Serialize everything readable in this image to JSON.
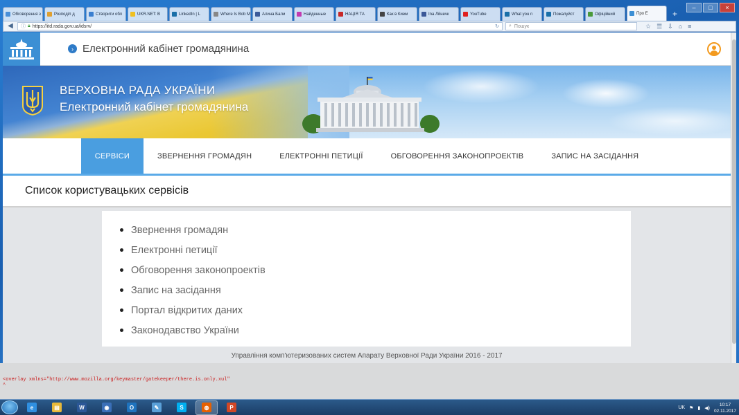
{
  "browser": {
    "tabs": [
      {
        "label": "Обговорення з",
        "color": "#4a8fd8"
      },
      {
        "label": "Розподіл д",
        "color": "#e0a030"
      },
      {
        "label": "Створити обл",
        "color": "#3a7fd0"
      },
      {
        "label": "UKR.NET: В",
        "color": "#f0c020"
      },
      {
        "label": "LinkedIn | L",
        "color": "#1a6fa8"
      },
      {
        "label": "Where Is Bob M",
        "color": "#888888"
      },
      {
        "label": "Алина Бали",
        "color": "#3c5a99"
      },
      {
        "label": "Найденные",
        "color": "#c23ab0"
      },
      {
        "label": "НАЦІЯ ТА",
        "color": "#c82828"
      },
      {
        "label": "Как в Кием",
        "color": "#444444"
      },
      {
        "label": "Ina Лйнечк",
        "color": "#3b5998"
      },
      {
        "label": "YouTube",
        "color": "#e02020"
      },
      {
        "label": "What you n",
        "color": "#1a6fa8"
      },
      {
        "label": "Пожалуйст",
        "color": "#1a6fa8"
      },
      {
        "label": "Офіційний",
        "color": "#4a9a3a"
      },
      {
        "label": "Про Е",
        "color": "#3c8fd4",
        "active": true
      }
    ],
    "url": "https://itd.rada.gov.ua/idsrv/",
    "search_placeholder": "Пошук"
  },
  "site": {
    "header_title": "Електронний кабінет громадянина",
    "banner_title": "ВЕРХОВНА РАДА УКРАЇНИ",
    "banner_subtitle": "Електронний кабінет громадянина",
    "nav": [
      {
        "label": "СЕРВІСИ",
        "active": true
      },
      {
        "label": "ЗВЕРНЕННЯ ГРОМАДЯН"
      },
      {
        "label": "ЕЛЕКТРОННІ ПЕТИЦІЇ"
      },
      {
        "label": "ОБГОВОРЕННЯ ЗАКОНОПРОЕКТІВ"
      },
      {
        "label": "ЗАПИС НА ЗАСІДАННЯ"
      }
    ],
    "page_title": "Список користувацьких сервісів",
    "services": [
      "Звернення громадян",
      "Електронні петиції",
      "Обговорення законопроектів",
      "Запис на засідання",
      "Портал відкритих даних",
      "Законодавство України"
    ],
    "footer": "Управління комп'ютеризованих систем Апарату Верховної Ради України 2016 - 2017"
  },
  "console_error": {
    "line1": "<overlay xmlns=\"http://www.mozilla.org/keymaster/gatekeeper/there.is.only.xul\"",
    "line2": "^"
  },
  "taskbar": {
    "apps": [
      "internet-explorer",
      "file-explorer",
      "word",
      "media",
      "outlook",
      "paint",
      "skype",
      "firefox",
      "powerpoint"
    ],
    "language": "UK",
    "time": "10:17",
    "date": "02.11.2017"
  },
  "colors": {
    "accent": "#4a9ee0",
    "user_icon": "#f39a1e",
    "error_text": "#c91b1b"
  }
}
